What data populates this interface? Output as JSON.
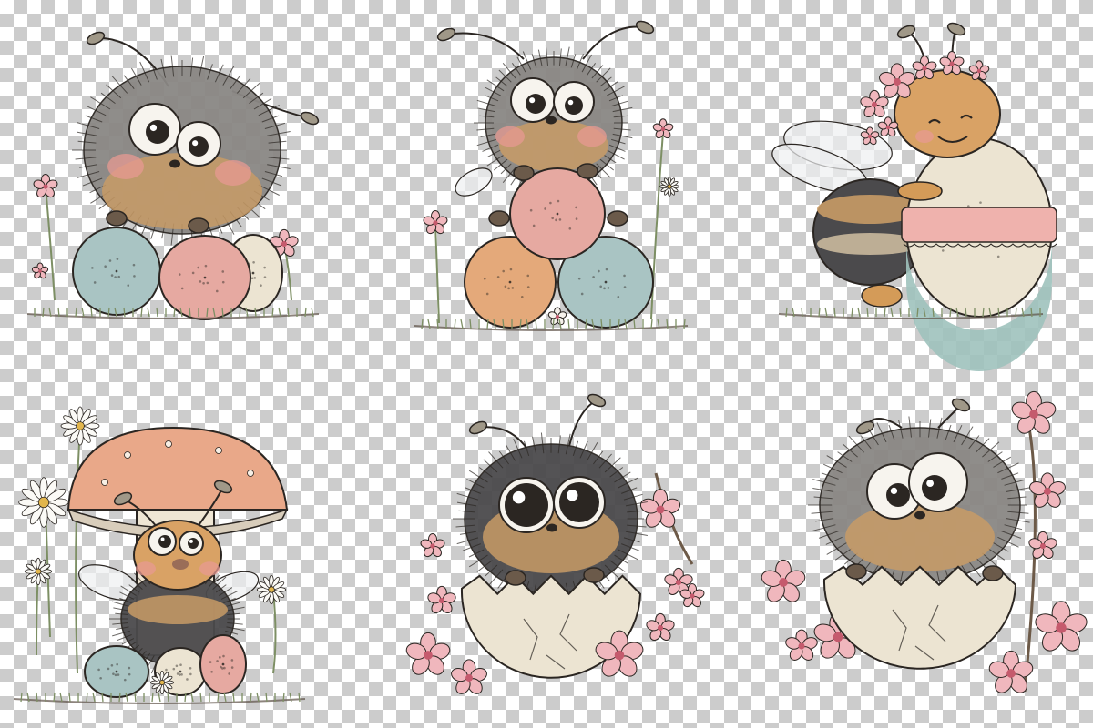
{
  "canvas": {
    "background": "transparency-checkerboard"
  },
  "palette": {
    "fur_dark": "#4b4a4c",
    "fur_mid": "#8a8784",
    "fur_tan": "#c89b66",
    "cheek": "#e79a92",
    "egg_blue": "#a9c4c3",
    "egg_pink": "#e6a9a1",
    "egg_peach": "#e4a97a",
    "egg_cream": "#ece4d2",
    "egg_teal": "#9fc2bd",
    "ribbon_pink": "#efb2ad",
    "mushroom_cap": "#e9a889",
    "blossom_pink": "#f0b7bd",
    "blossom_center": "#c55a6d",
    "stem_green": "#7d8f64",
    "ink": "#2b2622",
    "eye_white": "#f7f4ee"
  },
  "illustrations": [
    {
      "id": "bee-fuzzy-on-two-eggs",
      "eggs": [
        "egg_blue",
        "egg_pink",
        "egg_cream"
      ],
      "flowers": "pink-wildflowers"
    },
    {
      "id": "bee-hugging-egg-on-two-eggs",
      "eggs": [
        "egg_pink",
        "egg_peach",
        "egg_blue"
      ],
      "flowers": "pink-wildflowers"
    },
    {
      "id": "bee-flower-crown-with-ribbon-egg",
      "eggs": [
        "egg_cream",
        "egg_teal"
      ],
      "flowers": "flower-crown"
    },
    {
      "id": "bee-under-mushroom",
      "eggs": [
        "egg_blue",
        "egg_cream",
        "egg_pink"
      ],
      "flowers": "daisies"
    },
    {
      "id": "bee-in-cracked-egg-big-eyes",
      "eggs": [
        "egg_cream"
      ],
      "flowers": "cherry-blossoms"
    },
    {
      "id": "bee-in-cracked-egg-googly-eyes",
      "eggs": [
        "egg_cream"
      ],
      "flowers": "cherry-blossoms"
    }
  ]
}
